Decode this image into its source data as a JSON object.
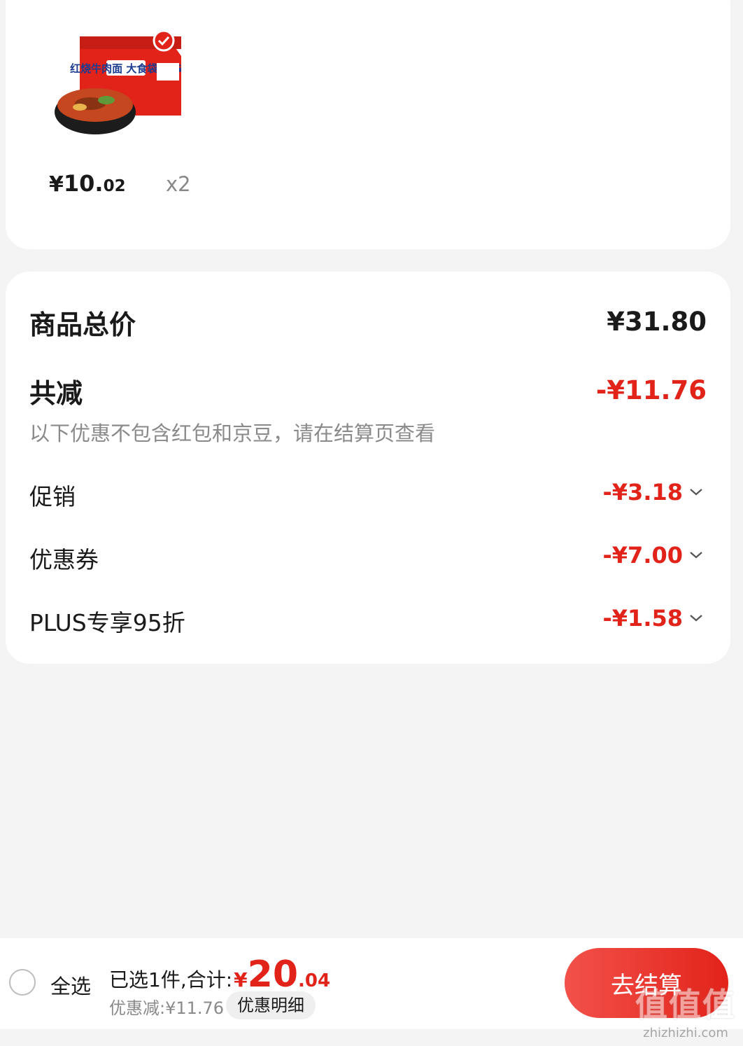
{
  "product": {
    "image_label": "红烧牛肉面 大食袋 BIG",
    "price_yen": "¥",
    "price_main": "10.",
    "price_cents": "02",
    "quantity": "x2"
  },
  "summary": {
    "total_label": "商品总价",
    "total_value": "¥31.80",
    "reduce_label": "共减",
    "reduce_value": "-¥11.76",
    "note": "以下优惠不包含红包和京豆，请在结算页查看",
    "items": [
      {
        "label": "促销",
        "value": "-¥3.18"
      },
      {
        "label": "优惠券",
        "value": "-¥7.00"
      },
      {
        "label": "PLUS专享95折",
        "value": "-¥1.58"
      }
    ]
  },
  "bottom": {
    "select_all": "全选",
    "selected_label": "已选1件,合计:",
    "yen": "¥",
    "total_big": "20",
    "total_small": ".04",
    "discount_text": "优惠减:¥11.76",
    "detail_button": "优惠明细",
    "checkout_button": "去结算"
  },
  "watermark": {
    "glyphs": "值值值",
    "url": "zhizhizhi.com"
  },
  "colors": {
    "accent": "#e2231a",
    "background": "#f4f4f4",
    "card": "#ffffff"
  }
}
